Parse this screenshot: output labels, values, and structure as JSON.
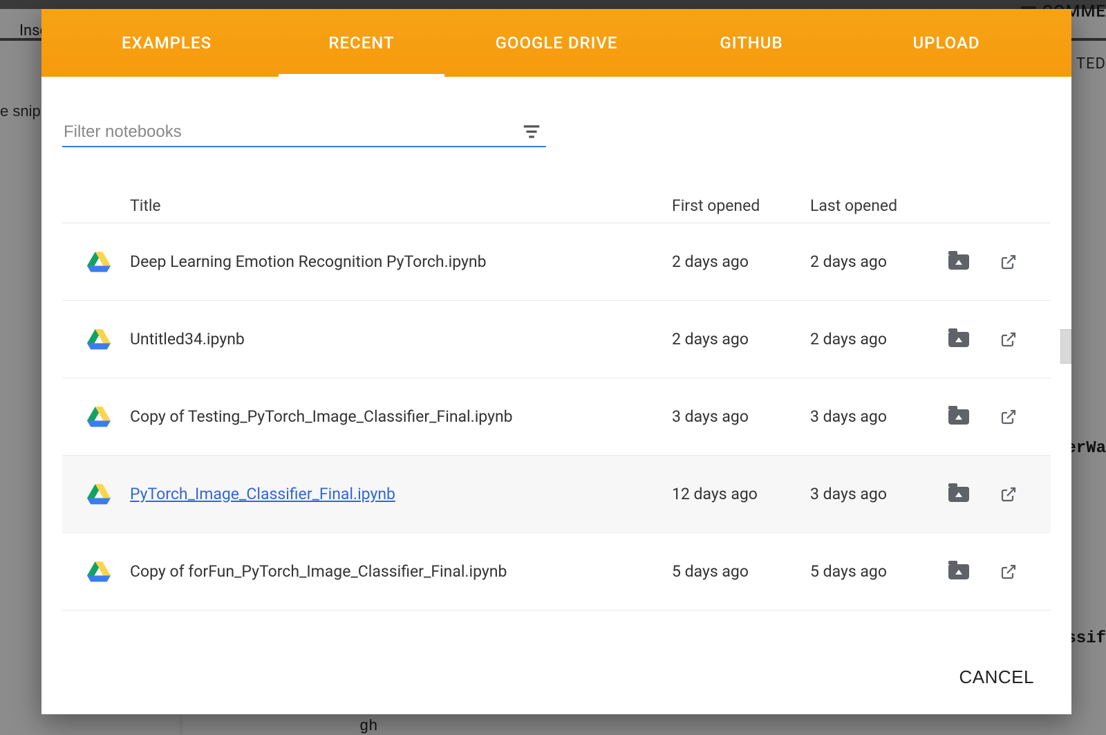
{
  "background": {
    "inse": "Inse",
    "snip": "e snip",
    "comme": "COMME",
    "ted": "TED",
    "erwa": "erWa",
    "ssif": "ssif",
    "gh": "gh"
  },
  "dialog": {
    "tabs": [
      {
        "label": "EXAMPLES",
        "active": false
      },
      {
        "label": "RECENT",
        "active": true
      },
      {
        "label": "GOOGLE DRIVE",
        "active": false
      },
      {
        "label": "GITHUB",
        "active": false
      },
      {
        "label": "UPLOAD",
        "active": false
      }
    ],
    "filter": {
      "placeholder": "Filter notebooks",
      "value": ""
    },
    "columns": {
      "title": "Title",
      "first_opened": "First opened",
      "last_opened": "Last opened"
    },
    "rows": [
      {
        "title": "Deep Learning Emotion Recognition PyTorch.ipynb",
        "first_opened": "2 days ago",
        "last_opened": "2 days ago",
        "hovered": false
      },
      {
        "title": "Untitled34.ipynb",
        "first_opened": "2 days ago",
        "last_opened": "2 days ago",
        "hovered": false
      },
      {
        "title": "Copy of Testing_PyTorch_Image_Classifier_Final.ipynb",
        "first_opened": "3 days ago",
        "last_opened": "3 days ago",
        "hovered": false
      },
      {
        "title": "PyTorch_Image_Classifier_Final.ipynb",
        "first_opened": "12 days ago",
        "last_opened": "3 days ago",
        "hovered": true
      },
      {
        "title": "Copy of forFun_PyTorch_Image_Classifier_Final.ipynb",
        "first_opened": "5 days ago",
        "last_opened": "5 days ago",
        "hovered": false
      }
    ],
    "cancel_label": "CANCEL"
  },
  "colors": {
    "accent": "#f79a0d",
    "link": "#3367d6",
    "filter_underline": "#3b78e7"
  }
}
